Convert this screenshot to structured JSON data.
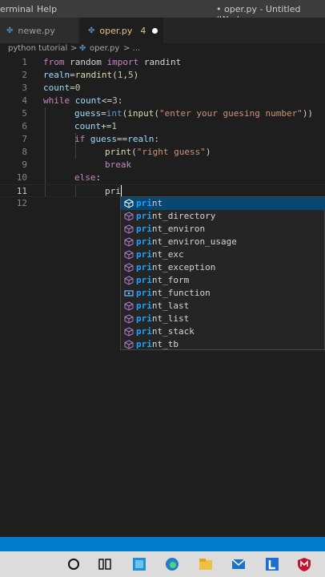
{
  "menubar": {
    "items": [
      "erminal",
      "Help"
    ],
    "title": "• oper.py - Untitled (Workspac"
  },
  "tabs": [
    {
      "label": "newe.py",
      "active": false
    },
    {
      "label": "oper.py",
      "active": true,
      "problems": "4"
    }
  ],
  "breadcrumb": {
    "folder": "python tutorial",
    "sep": ">",
    "file": "oper.py",
    "more": "> ..."
  },
  "editor": {
    "lines": [
      {
        "n": "1"
      },
      {
        "n": "2"
      },
      {
        "n": "3"
      },
      {
        "n": "4"
      },
      {
        "n": "5"
      },
      {
        "n": "6"
      },
      {
        "n": "7"
      },
      {
        "n": "8"
      },
      {
        "n": "9"
      },
      {
        "n": "10"
      },
      {
        "n": "11"
      },
      {
        "n": "12"
      }
    ],
    "tokens": {
      "l1_from": "from",
      "l1_mod": " random ",
      "l1_import": "import",
      "l1_name": " randint",
      "l2_var": "realn",
      "l2_eq": "=",
      "l2_fn": "randint",
      "l2_open": "(",
      "l2_a": "1",
      "l2_comma": ",",
      "l2_b": "5",
      "l2_close": ")",
      "l3_var": "count",
      "l3_eq": "=",
      "l3_val": "0",
      "l4_while": "while",
      "l4_var": " count",
      "l4_op": "<=",
      "l4_val": "3",
      "l4_colon": ":",
      "l5_var": "guess",
      "l5_eq": "=",
      "l5_int": "int",
      "l5_p1": "(",
      "l5_input": "input",
      "l5_p2": "(",
      "l5_str": "\"enter your guesing number\"",
      "l5_p3": "))",
      "l6_var": "count",
      "l6_op": "+=",
      "l6_val": "1",
      "l7_if": "if",
      "l7_var": " guess",
      "l7_op": "==",
      "l7_var2": "realn",
      "l7_colon": ":",
      "l8_fn": "print",
      "l8_p1": "(",
      "l8_str": "\"right guess\"",
      "l8_p2": ")",
      "l9_break": "break",
      "l10_else": "else",
      "l10_colon": ":",
      "l11_typed": "pri"
    }
  },
  "suggestions": [
    {
      "match": "pri",
      "rest": "nt",
      "icon": "method-cube-icon",
      "selected": true
    },
    {
      "match": "pri",
      "rest": "nt_directory",
      "icon": "method-cube-icon"
    },
    {
      "match": "pri",
      "rest": "nt_environ",
      "icon": "method-cube-icon"
    },
    {
      "match": "pri",
      "rest": "nt_environ_usage",
      "icon": "method-cube-icon"
    },
    {
      "match": "pri",
      "rest": "nt_exc",
      "icon": "method-cube-icon"
    },
    {
      "match": "pri",
      "rest": "nt_exception",
      "icon": "method-cube-icon"
    },
    {
      "match": "pri",
      "rest": "nt_form",
      "icon": "method-cube-icon"
    },
    {
      "match": "pri",
      "rest": "nt_function",
      "icon": "variable-icon"
    },
    {
      "match": "pri",
      "rest": "nt_last",
      "icon": "method-cube-icon"
    },
    {
      "match": "pri",
      "rest": "nt_list",
      "icon": "method-cube-icon"
    },
    {
      "match": "pri",
      "rest": "nt_stack",
      "icon": "method-cube-icon"
    },
    {
      "match": "pri",
      "rest": "nt_tb",
      "icon": "method-cube-icon"
    }
  ],
  "taskbar": {
    "icons": [
      "cortana-circle-icon",
      "task-view-icon",
      "store-icon",
      "edge-icon",
      "file-explorer-icon",
      "mail-icon",
      "word-l-icon",
      "mcafee-icon"
    ]
  },
  "colors": {
    "accent": "#007acc",
    "keyword": "#c586c0",
    "function": "#dcdcaa",
    "string": "#ce9178",
    "match": "#18a3ff"
  }
}
